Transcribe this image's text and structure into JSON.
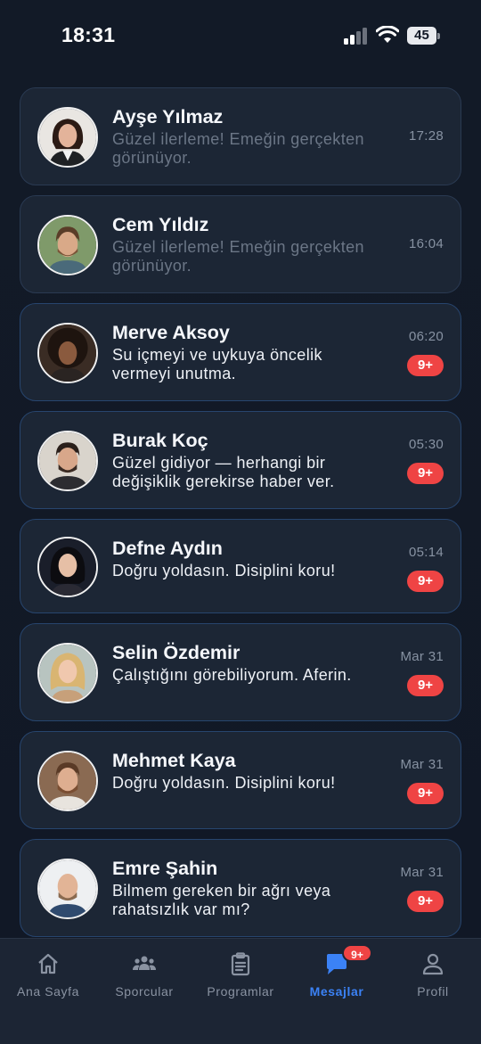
{
  "status_bar": {
    "time": "18:31",
    "battery": "45"
  },
  "conversations": [
    {
      "name": "Ayşe Yılmaz",
      "preview": "Güzel ilerleme! Emeğin gerçekten görünüyor.",
      "time": "17:28",
      "unread": false,
      "badge": ""
    },
    {
      "name": "Cem Yıldız",
      "preview": "Güzel ilerleme! Emeğin gerçekten görünüyor.",
      "time": "16:04",
      "unread": false,
      "badge": ""
    },
    {
      "name": "Merve Aksoy",
      "preview": "Su içmeyi ve uykuya öncelik vermeyi unutma.",
      "time": "06:20",
      "unread": true,
      "badge": "9+"
    },
    {
      "name": "Burak Koç",
      "preview": "Güzel gidiyor — herhangi bir değişiklik gerekirse haber ver.",
      "time": "05:30",
      "unread": true,
      "badge": "9+"
    },
    {
      "name": "Defne Aydın",
      "preview": "Doğru yoldasın. Disiplini koru!",
      "time": "05:14",
      "unread": true,
      "badge": "9+"
    },
    {
      "name": "Selin Özdemir",
      "preview": "Çalıştığını görebiliyorum. Aferin.",
      "time": "Mar 31",
      "unread": true,
      "badge": "9+"
    },
    {
      "name": "Mehmet Kaya",
      "preview": "Doğru yoldasın. Disiplini koru!",
      "time": "Mar 31",
      "unread": true,
      "badge": "9+"
    },
    {
      "name": "Emre Şahin",
      "preview": "Bilmem gereken bir ağrı veya rahatsızlık var mı?",
      "time": "Mar 31",
      "unread": true,
      "badge": "9+"
    }
  ],
  "tabs": [
    {
      "label": "Ana Sayfa",
      "icon": "home-icon",
      "active": false
    },
    {
      "label": "Sporcular",
      "icon": "athletes-icon",
      "active": false
    },
    {
      "label": "Programlar",
      "icon": "clipboard-icon",
      "active": false
    },
    {
      "label": "Mesajlar",
      "icon": "chat-icon",
      "active": true,
      "badge": "9+"
    },
    {
      "label": "Profil",
      "icon": "user-icon",
      "active": false
    }
  ],
  "colors": {
    "accent": "#3b82f6",
    "badge": "#ef4444",
    "background": "#111826",
    "card": "#1c2635"
  }
}
